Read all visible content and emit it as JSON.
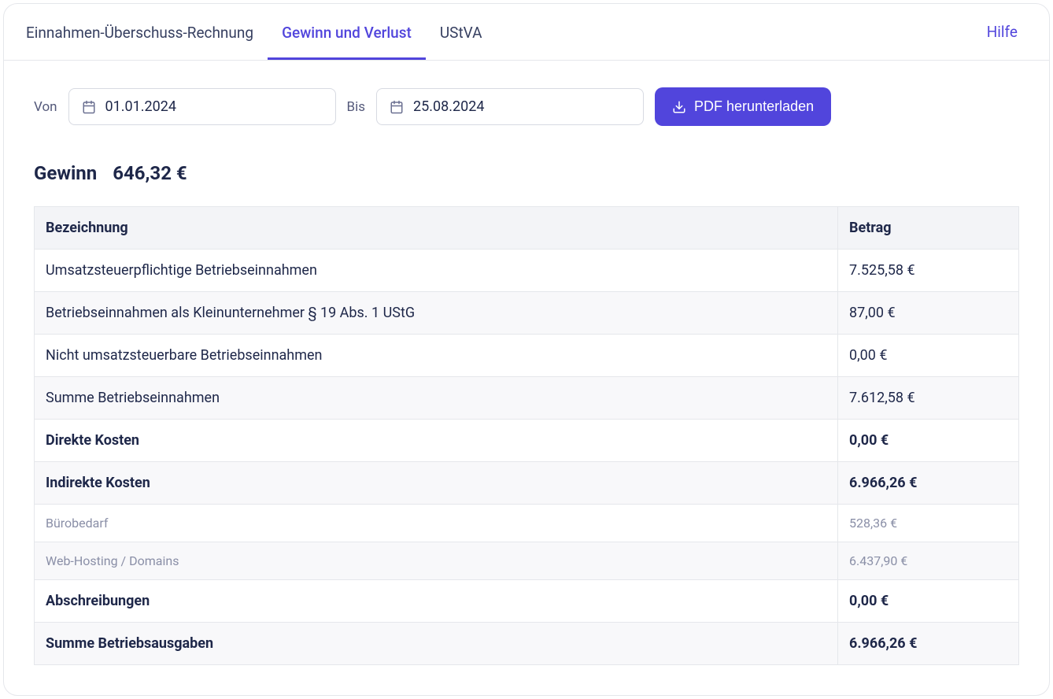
{
  "tabs": {
    "items": [
      {
        "label": "Einnahmen-Überschuss-Rechnung",
        "active": false
      },
      {
        "label": "Gewinn und Verlust",
        "active": true
      },
      {
        "label": "UStVA",
        "active": false
      }
    ],
    "help": "Hilfe"
  },
  "filters": {
    "from_label": "Von",
    "from_value": "01.01.2024",
    "to_label": "Bis",
    "to_value": "25.08.2024",
    "download_label": "PDF herunterladen"
  },
  "summary": {
    "label": "Gewinn",
    "value": "646,32 €"
  },
  "table": {
    "headers": {
      "name": "Bezeichnung",
      "amount": "Betrag"
    },
    "rows": [
      {
        "name": "Umsatzsteuerpflichtige Betriebseinnahmen",
        "amount": "7.525,58 €",
        "bold": false,
        "alt": false,
        "sub": false
      },
      {
        "name": "Betriebseinnahmen als Kleinunternehmer § 19 Abs. 1 UStG",
        "amount": "87,00 €",
        "bold": false,
        "alt": true,
        "sub": false
      },
      {
        "name": "Nicht umsatzsteuerbare Betriebseinnahmen",
        "amount": "0,00 €",
        "bold": false,
        "alt": false,
        "sub": false
      },
      {
        "name": "Summe Betriebseinnahmen",
        "amount": "7.612,58 €",
        "bold": false,
        "alt": true,
        "sub": false
      },
      {
        "name": "Direkte Kosten",
        "amount": "0,00 €",
        "bold": true,
        "alt": false,
        "sub": false
      },
      {
        "name": "Indirekte Kosten",
        "amount": "6.966,26 €",
        "bold": true,
        "alt": true,
        "sub": false
      },
      {
        "name": "Bürobedarf",
        "amount": "528,36 €",
        "bold": false,
        "alt": false,
        "sub": true
      },
      {
        "name": "Web-Hosting / Domains",
        "amount": "6.437,90 €",
        "bold": false,
        "alt": true,
        "sub": true
      },
      {
        "name": "Abschreibungen",
        "amount": "0,00 €",
        "bold": true,
        "alt": false,
        "sub": false
      },
      {
        "name": "Summe Betriebsausgaben",
        "amount": "6.966,26 €",
        "bold": true,
        "alt": true,
        "sub": false
      }
    ]
  }
}
